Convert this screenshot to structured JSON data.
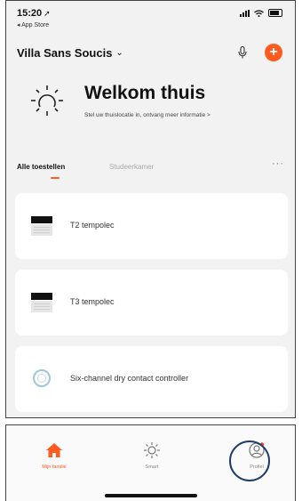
{
  "status_bar": {
    "time": "15:20",
    "back_app": "◂ App Store"
  },
  "header": {
    "home_name": "Villa Sans Soucis",
    "dropdown_icon": "chevron-down-icon",
    "mic_icon": "microphone-icon",
    "add_icon": "plus-icon",
    "add_symbol": "+"
  },
  "welcome": {
    "title": "Welkom thuis",
    "subtitle": "Stel uw thuislocatie in, ontvang meer informatie >",
    "icon": "sun-icon"
  },
  "tabs": {
    "active": "Alle toestellen",
    "inactive": "Studeerkamer",
    "more": "···"
  },
  "devices": [
    {
      "name": "T2 tempolec",
      "icon": "switch-panel-icon"
    },
    {
      "name": "T3 tempolec",
      "icon": "switch-panel-icon"
    },
    {
      "name": "Six-channel dry contact controller",
      "icon": "controller-icon"
    }
  ],
  "bottom_nav": [
    {
      "label": "Mijn familie",
      "icon": "home-icon",
      "active": true
    },
    {
      "label": "Smart",
      "icon": "sun-icon",
      "active": false
    },
    {
      "label": "Profiel",
      "icon": "profile-icon",
      "active": false
    }
  ],
  "colors": {
    "accent": "#ff5a1f",
    "highlight_ring": "#1f3d6b",
    "background": "#f2f2f2",
    "card": "#ffffff"
  }
}
